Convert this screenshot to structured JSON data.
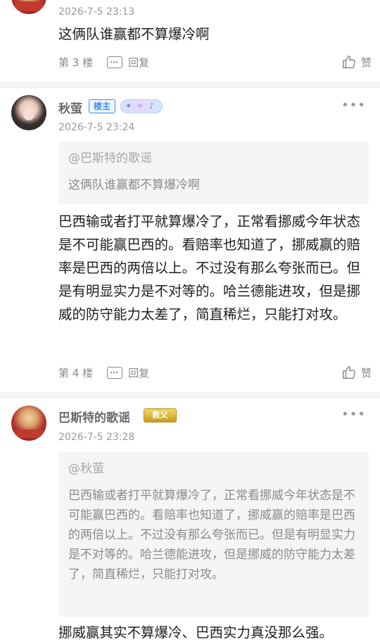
{
  "post1": {
    "time": "2026-7-5 23:13",
    "content": "这俩队谁赢都不算爆冷啊",
    "floor": "第 3 楼",
    "reply_label": "回复",
    "like_label": "赞"
  },
  "post2": {
    "name": "秋萤",
    "owner_badge": "楼主",
    "time": "2026-7-5 23:24",
    "quote_at": "@巴斯特的歌谣",
    "quote_text": "这俩队谁赢都不算爆冷啊",
    "content": "巴西输或者打平就算爆冷了，正常看挪威今年状态是不可能赢巴西的。看赔率也知道了，挪威赢的赔率是巴西的两倍以上。不过没有那么夸张而已。但是有明显实力是不对等的。哈兰德能进攻，但是挪威的防守能力太差了，简直稀烂，只能打对攻。",
    "floor": "第 4 楼",
    "reply_label": "回复",
    "like_label": "赞"
  },
  "post3": {
    "name": "巴斯特的歌谣",
    "title_badge": "教父",
    "time": "2026-7-5 23:28",
    "quote_at": "@秋萤",
    "quote_text": "巴西输或者打平就算爆冷了，正常看挪威今年状态是不可能赢巴西的。看赔率也知道了，挪威赢的赔率是巴西的两倍以上。不过没有那么夸张而已。但是有明显实力是不对等的。哈兰德能进攻，但是挪威的防守能力太差了，简直稀烂，只能打对攻。",
    "content": "挪威赢其实不算爆冷、巴西实力真没那么强。"
  },
  "colors": {
    "accent_blue": "#3b8ef0",
    "gold_badge": "#c99a1e",
    "divider": "#f4f4f6",
    "quote_bg": "#f5f5f7"
  },
  "icons": {
    "reply": "comment-icon",
    "like": "thumbs-up-icon",
    "more": "more-dots-icon"
  }
}
